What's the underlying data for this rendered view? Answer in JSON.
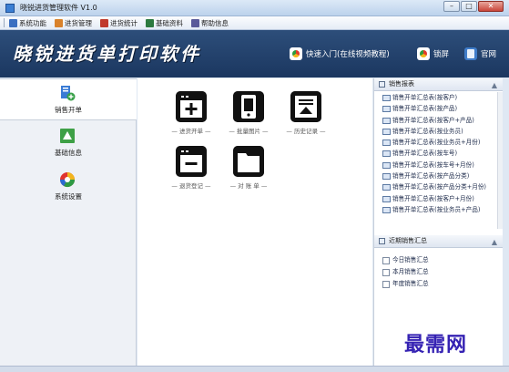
{
  "window": {
    "title": "晓锐进货管理软件 V1.0",
    "buttons": [
      "–",
      "□",
      "✕"
    ]
  },
  "toolbar": {
    "items": [
      {
        "label": "系统功能",
        "icon": "system-icon",
        "color": "#3a6fc1"
      },
      {
        "label": "进货管理",
        "icon": "purchase-icon",
        "color": "#d9822b"
      },
      {
        "label": "进货统计",
        "icon": "stats-icon",
        "color": "#c0392b"
      },
      {
        "label": "基础资料",
        "icon": "data-icon",
        "color": "#2c7a3f"
      },
      {
        "label": "帮助信息",
        "icon": "help-icon",
        "color": "#5a5a9a"
      }
    ]
  },
  "banner": {
    "logo_text": "晓锐进货单打印软件",
    "links": [
      {
        "label": "快速入门(在线视频教程)",
        "icon": "start-icon"
      },
      {
        "label": "锁屏",
        "icon": "lock-icon"
      },
      {
        "label": "官网",
        "icon": "website-icon"
      }
    ]
  },
  "leftnav": {
    "items": [
      {
        "label": "销售开单",
        "icon": "sales-order-icon",
        "active": true
      },
      {
        "label": "基础信息",
        "icon": "basic-info-icon",
        "active": false
      },
      {
        "label": "系统设置",
        "icon": "settings-icon",
        "active": false
      }
    ]
  },
  "workspace": {
    "tiles": [
      {
        "label": "— 进货开单 —",
        "icon": "new-order-icon"
      },
      {
        "label": "— 批量图片 —",
        "icon": "phone-icon"
      },
      {
        "label": "— 历史记录 —",
        "icon": "history-icon"
      },
      {
        "label": "— 退货登记 —",
        "icon": "return-icon"
      },
      {
        "label": "— 对 账 单 —",
        "icon": "statement-icon"
      }
    ]
  },
  "rightpanel": {
    "reports_header": "销售报表",
    "reports": [
      "销售开单汇总表(按客户)",
      "销售开单汇总表(按产品)",
      "销售开单汇总表(按客户+产品)",
      "销售开单汇总表(按业务员)",
      "销售开单汇总表(按业务员+月份)",
      "销售开单汇总表(按车号)",
      "销售开单汇总表(按车号+月份)",
      "销售开单汇总表(按产品分类)",
      "销售开单汇总表(按产品分类+月份)",
      "销售开单汇总表(按客户+月份)",
      "销售开单汇总表(按业务员+产品)"
    ],
    "monthly_header": "近期销售汇总",
    "monthly": [
      "今日销售汇总",
      "本月销售汇总",
      "年度销售汇总"
    ]
  },
  "watermark": "最需网"
}
